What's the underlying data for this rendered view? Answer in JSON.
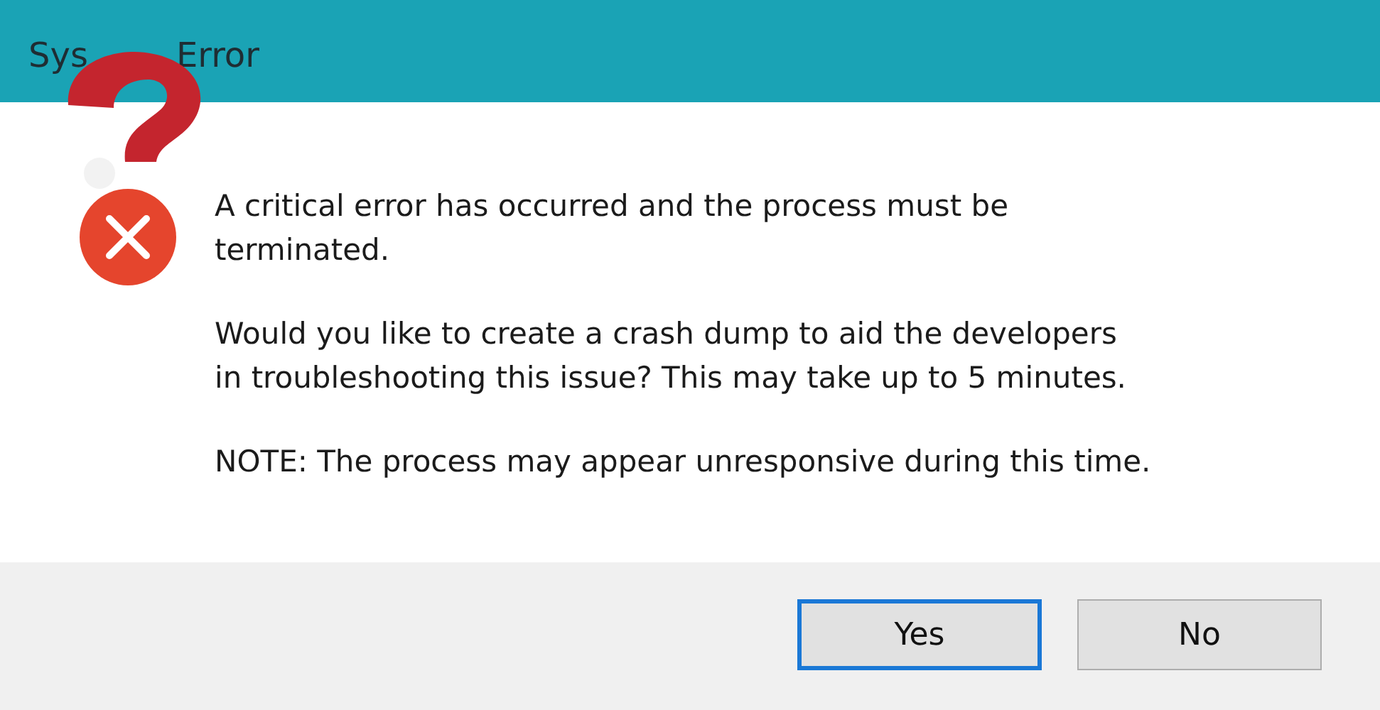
{
  "window": {
    "title_parts": [
      "Sys",
      "Error"
    ]
  },
  "messages": [
    "A critical error has occurred and the process must be terminated.",
    "Would you like to create a crash dump to aid the developers in troubleshooting this issue? This may take up to 5 minutes.",
    "NOTE: The process may appear unresponsive during this time."
  ],
  "buttons": [
    {
      "label": "Yes",
      "selected": true
    },
    {
      "label": "No",
      "selected": false
    }
  ]
}
